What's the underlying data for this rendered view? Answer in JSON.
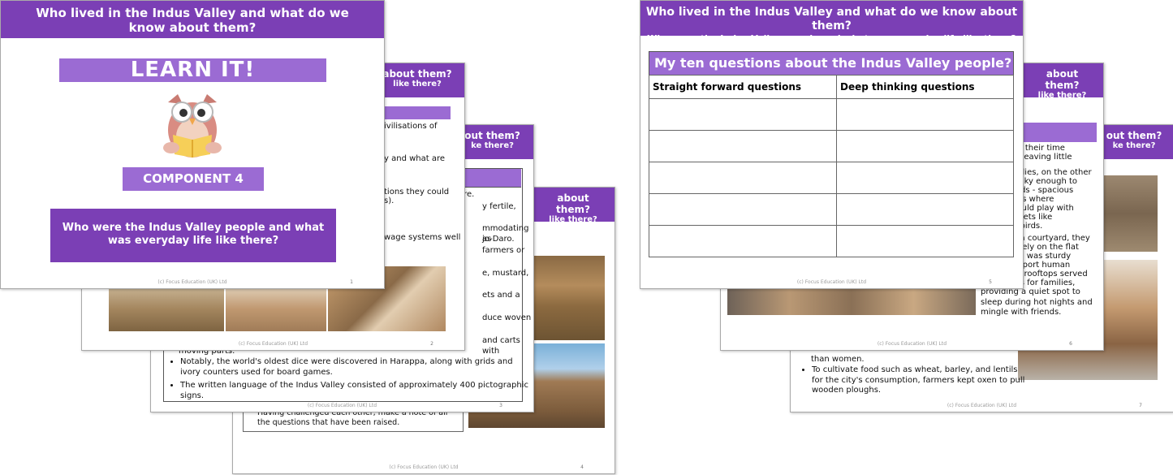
{
  "left_group": {
    "slide1": {
      "title": "Who lived in the Indus Valley and what do we know about them?",
      "learn_it": "LEARN IT!",
      "component": "COMPONENT 4",
      "subtitle": "Who were the Indus Valley people and what was everyday life like there?",
      "footer": "(c) Focus Education (UK) Ltd",
      "page": "1"
    },
    "slide2": {
      "hdr1": "about them?",
      "hdr2": "like there?",
      "frag1": "ivilisations of",
      "frag2": "y and what are",
      "frag3": "tions they could",
      "frag4": "s).",
      "frag5": "wage systems well",
      "footer": "(c) Focus Education (UK) Ltd",
      "page": "2"
    },
    "slide3": {
      "hdr1": "out them?",
      "hdr2": "ke there?",
      "frag1": "ed there.",
      "frag2": "y fertile,",
      "frag3": "mmodating as",
      "frag4": "jo-Daro.",
      "frag5": "farmers or",
      "frag6": "e, mustard,",
      "frag7": "ets and a",
      "frag8": "duce woven",
      "frag9": "and carts with",
      "frag10": "moving parts.",
      "bullets": [
        "Notably, the world's oldest dice were discovered in Harappa, along with grids and ivory counters used for board games.",
        "The written language of the Indus Valley consisted of approximately 400 pictographic signs."
      ],
      "footer": "(c) Focus Education (UK) Ltd",
      "page": "3"
    },
    "slide4": {
      "hdr1": "about them?",
      "hdr2": "like there?",
      "note": "Having challenged each other, make a note of all the questions that have been raised.",
      "footer": "(c) Focus Education (UK) Ltd",
      "page": "4"
    }
  },
  "right_group": {
    "slide5": {
      "title": "Who lived in the Indus Valley and what do we know about them?",
      "subtitle": "Who were the Indus Valley people and what was everyday life like there?",
      "table_title": "My ten questions about the Indus Valley people?",
      "col1": "Straight forward questions",
      "col2": "Deep thinking questions",
      "footer": "(c) Focus Education (UK) Ltd",
      "page": "5"
    },
    "slide6": {
      "hdr1": "about them?",
      "hdr2": "like there?",
      "frag1": "nd their time",
      "frag2": "s, leaving little",
      "frag3": "milies, on the other",
      "frag4": "lucky enough to",
      "frag5": "ards - spacious",
      "frag6": "eas where",
      "frag7": "could play with",
      "frag8": "r pets like",
      "frag9": "d birds.",
      "frag10": "d a courtyard, they",
      "frag11": "s rely on the flat",
      "frag12": "ich was sturdy",
      "frag13": "upport human",
      "frag14": "se rooftops served",
      "frag15": "ms for families,",
      "frag16": "providing a quiet spot to sleep during hot nights and mingle with friends.",
      "footer": "(c) Focus Education (UK) Ltd",
      "page": "6"
    },
    "slide7": {
      "hdr1": "out them?",
      "hdr2": "ke there?",
      "frag1": "than women.",
      "bullet": "To cultivate food such as wheat, barley, and lentils for the city's consumption, farmers kept oxen to pull wooden ploughs.",
      "footer": "(c) Focus Education (UK) Ltd",
      "page": "7"
    }
  },
  "colors": {
    "purple": "#7b3fb5",
    "light_purple": "#9b6bd3"
  }
}
